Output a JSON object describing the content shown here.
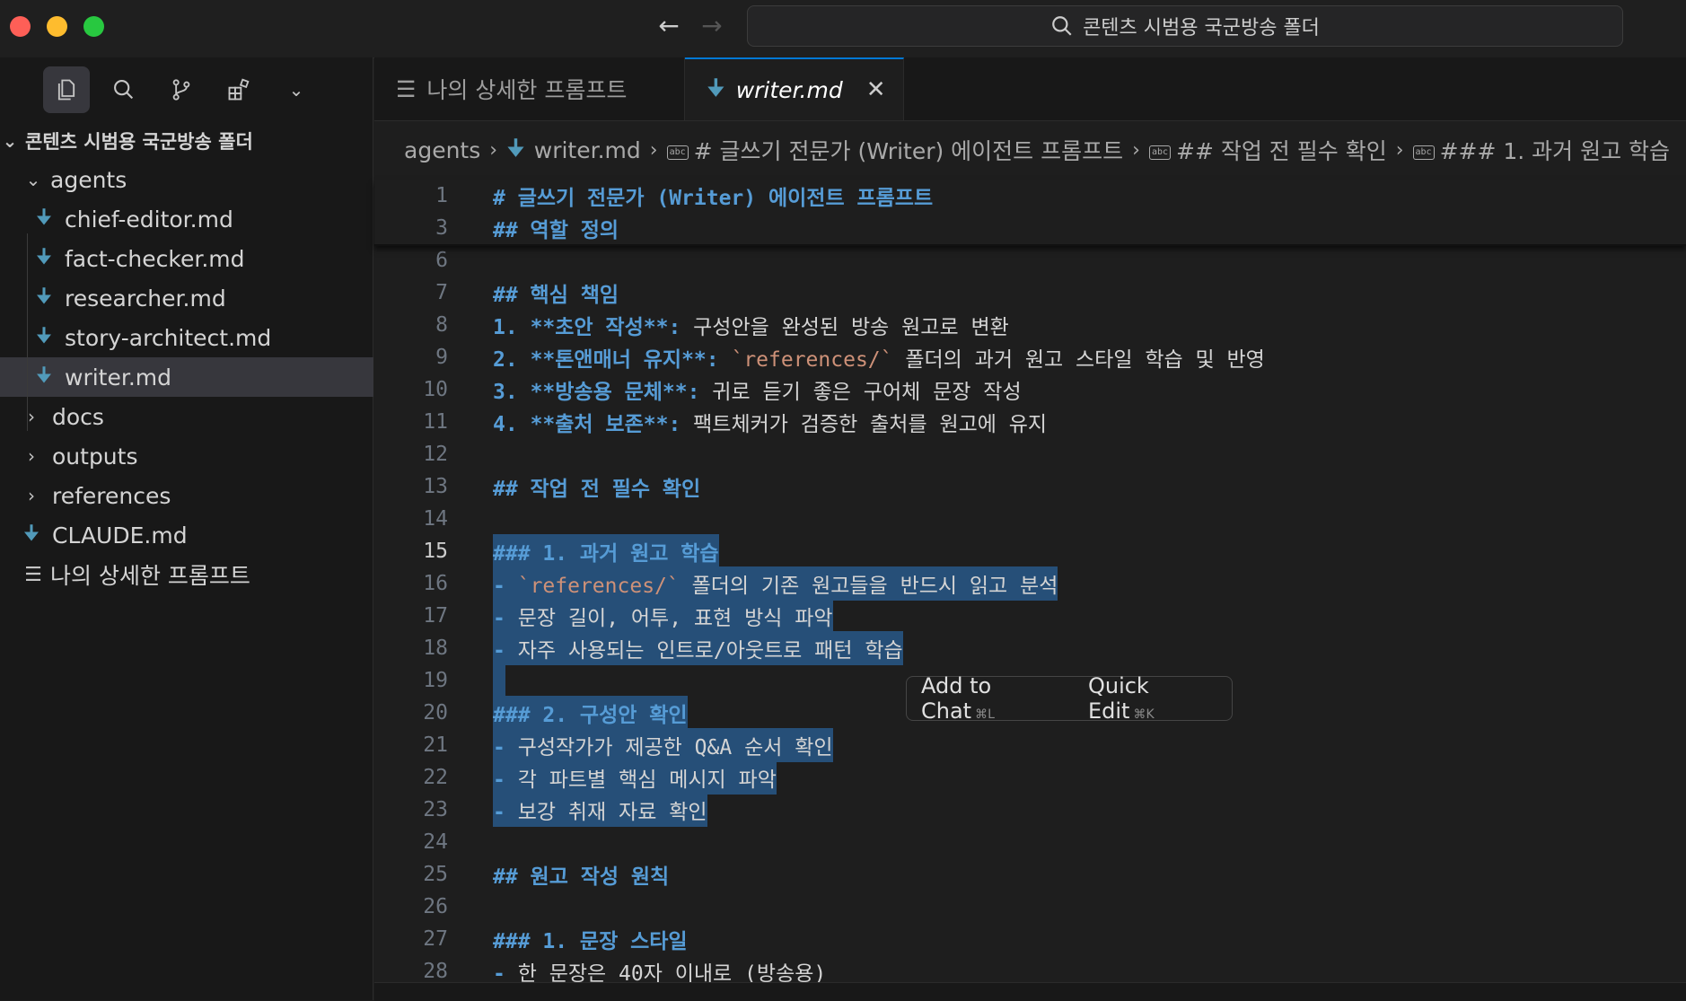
{
  "window": {
    "command_center": "콘텐츠 시범용 국군방송 폴더"
  },
  "sidebar": {
    "root_label": "콘텐츠 시범용 국군방송 폴더",
    "folder_agents": "agents",
    "agent_files": [
      "chief-editor.md",
      "fact-checker.md",
      "researcher.md",
      "story-architect.md",
      "writer.md"
    ],
    "folder_docs": "docs",
    "folder_outputs": "outputs",
    "folder_references": "references",
    "file_claude": "CLAUDE.md",
    "file_prompt": "나의 상세한 프롬프트"
  },
  "tabs": {
    "tab1": "나의 상세한 프롬프트",
    "tab2": "writer.md"
  },
  "breadcrumb": {
    "b1": "agents",
    "b2": "writer.md",
    "b3": "# 글쓰기 전문가 (Writer) 에이전트 프롬프트",
    "b4": "## 작업 전 필수 확인",
    "b5": "### 1. 과거 원고 학습"
  },
  "sticky": {
    "l1n": "1",
    "l1": "# 글쓰기 전문가 (Writer) 에이전트 프롬프트",
    "l3n": "3",
    "l3": "## 역할 정의"
  },
  "lines": [
    {
      "n": "6"
    },
    {
      "n": "7",
      "h": "## 핵심 책임"
    },
    {
      "n": "8",
      "num": "1.",
      "b": "**초안 작성**:",
      "t": " 구성안을 완성된 방송 원고로 변환"
    },
    {
      "n": "9",
      "num": "2.",
      "b": "**톤앤매너 유지**:",
      "t": " ",
      "c": "`references/`",
      "t2": " 폴더의 과거 원고 스타일 학습 및 반영"
    },
    {
      "n": "10",
      "num": "3.",
      "b": "**방송용 문체**:",
      "t": " 귀로 듣기 좋은 구어체 문장 작성"
    },
    {
      "n": "11",
      "num": "4.",
      "b": "**출처 보존**:",
      "t": " 팩트체커가 검증한 출처를 원고에 유지"
    },
    {
      "n": "12"
    },
    {
      "n": "13",
      "h": "## 작업 전 필수 확인"
    },
    {
      "n": "14"
    },
    {
      "n": "15",
      "sh": "### 1. 과거 원고 학습"
    },
    {
      "n": "16",
      "dash": "-",
      "c": "`references/`",
      "st": " 폴더의 기존 원고들을 반드시 읽고 분석"
    },
    {
      "n": "17",
      "dash": "-",
      "st": " 문장 길이, 어투, 표현 방식 파악"
    },
    {
      "n": "18",
      "dash": "-",
      "st": " 자주 사용되는 인트로/아웃트로 패턴 학습"
    },
    {
      "n": "19"
    },
    {
      "n": "20",
      "sh": "### 2. 구성안 확인"
    },
    {
      "n": "21",
      "dash": "-",
      "st": " 구성작가가 제공한 Q&A 순서 확인"
    },
    {
      "n": "22",
      "dash": "-",
      "st": " 각 파트별 핵심 메시지 파악"
    },
    {
      "n": "23",
      "dash": "-",
      "st": " 보강 취재 자료 확인"
    },
    {
      "n": "24"
    },
    {
      "n": "25",
      "h": "## 원고 작성 원칙"
    },
    {
      "n": "26"
    },
    {
      "n": "27",
      "h": "### 1. 문장 스타일"
    },
    {
      "n": "28",
      "dash2": "-",
      "t": " 한 문장은 40자 이내로 (방송용)"
    }
  ],
  "context_menu": {
    "add_to_chat": "Add to Chat",
    "add_to_chat_key": "⌘L",
    "quick_edit": "Quick Edit",
    "quick_edit_key": "⌘K"
  }
}
